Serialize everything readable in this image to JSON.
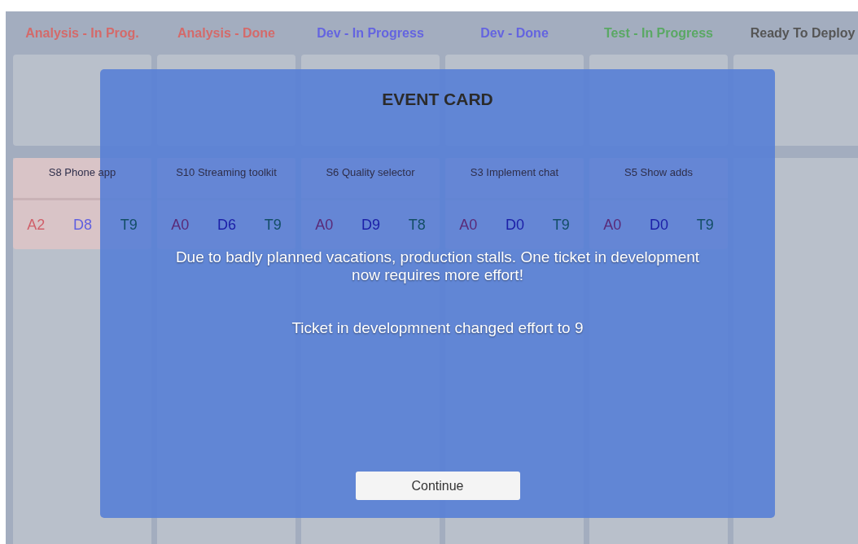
{
  "columns": [
    {
      "title": "Analysis - In Prog.",
      "color": "#d46a6a",
      "cards": [
        {
          "name": "S8 Phone app",
          "efforts": [
            "A2",
            "D8",
            "T9"
          ]
        }
      ]
    },
    {
      "title": "Analysis - Done",
      "color": "#d46a6a",
      "cards": [
        {
          "name": "S10 Streaming toolkit",
          "efforts": [
            "A0",
            "D6",
            "T9"
          ]
        }
      ]
    },
    {
      "title": "Dev - In Progress",
      "color": "#6464e0",
      "cards": [
        {
          "name": "S6 Quality selector",
          "efforts": [
            "A0",
            "D9",
            "T8"
          ]
        }
      ]
    },
    {
      "title": "Dev - Done",
      "color": "#6464e0",
      "cards": [
        {
          "name": "S3 Implement chat",
          "efforts": [
            "A0",
            "D0",
            "T9"
          ]
        }
      ]
    },
    {
      "title": "Test - In Progress",
      "color": "#5aa864",
      "cards": [
        {
          "name": "S5 Show adds",
          "efforts": [
            "A0",
            "D0",
            "T9"
          ]
        }
      ]
    },
    {
      "title": "Ready To Deploy",
      "color": "#555555"
    }
  ],
  "modal": {
    "title": "EVENT CARD",
    "message": "Due to badly planned vacations, production stalls. One ticket in development now requires more effort!",
    "detail": "Ticket in developmnent changed effort to 9",
    "button": "Continue"
  }
}
